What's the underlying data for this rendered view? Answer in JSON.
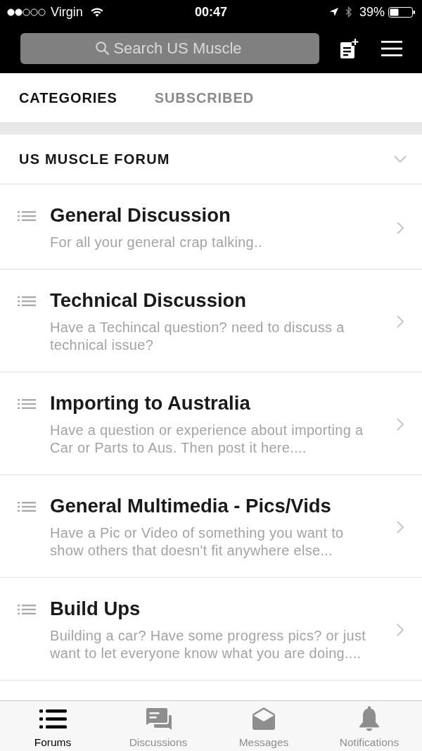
{
  "status_bar": {
    "carrier": "Virgin",
    "time": "00:47",
    "battery": "39%"
  },
  "search": {
    "placeholder": "Search US Muscle"
  },
  "tabs": [
    {
      "label": "CATEGORIES",
      "selected": true
    },
    {
      "label": "SUBSCRIBED",
      "selected": false
    }
  ],
  "section": {
    "title": "US MUSCLE FORUM",
    "expanded": true
  },
  "forums": [
    {
      "title": "General Discussion",
      "description": "For all your general crap talking.."
    },
    {
      "title": "Technical Discussion",
      "description": "Have a Techincal question? need to discuss a technical issue?"
    },
    {
      "title": "Importing to Australia",
      "description": "Have a question or experience about importing a Car or Parts to Aus. Then post it here...."
    },
    {
      "title": "General Multimedia - Pics/Vids",
      "description": "Have a Pic or Video of something you want to show others that doesn't fit anywhere else..."
    },
    {
      "title": "Build Ups",
      "description": "Building a car? Have some progress pics? or just want to let everyone know what you are doing...."
    }
  ],
  "tab_bar": [
    {
      "label": "Forums",
      "kind": "list",
      "selected": true
    },
    {
      "label": "Discussions",
      "kind": "chat",
      "selected": false
    },
    {
      "label": "Messages",
      "kind": "envelope",
      "selected": false
    },
    {
      "label": "Notifications",
      "kind": "bell",
      "selected": false
    }
  ]
}
